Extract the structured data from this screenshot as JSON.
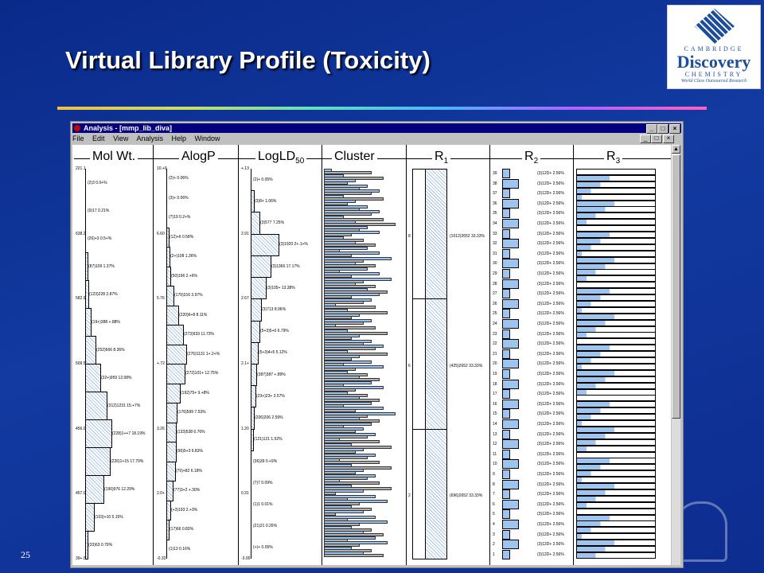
{
  "slide": {
    "title": "Virtual Library Profile (Toxicity)",
    "page_number": "25",
    "logo": {
      "line1": "CAMBRIDGE",
      "line2": "Discovery",
      "line3": "CHEMISTRY",
      "tagline": "World Class Outsourced Research"
    }
  },
  "window": {
    "title": "Analysis - [mmp_lib_diva]",
    "menu": [
      "File",
      "Edit",
      "View",
      "Analysis",
      "Help",
      "Window"
    ],
    "controls": {
      "minimize": "_",
      "maximize": "□",
      "close": "×"
    }
  },
  "columns": {
    "mol_wt": {
      "header": "Mol Wt.",
      "ticks": [
        "221.1",
        "638.2",
        "582.9",
        "509.5",
        "456.0",
        "457.0",
        "39+.5"
      ],
      "labels": [
        "(2)3 0.0+%",
        "(9)17 0.21%",
        "(26)+3 0.5+%",
        "(87)109 1.37%",
        "(123)228 2.87%",
        "(19+)388 +.88%",
        "(252)666 8.36%",
        "(32+)959 12.08%",
        "(312)1231 15.+7%",
        "(228)1++7 18.19%",
        "(226)1+15 17.79%",
        "(190)976 12.29%",
        "(103)+10 5.15%",
        "(33)63 0.79%"
      ]
    },
    "alogp": {
      "header": "AlogP",
      "ticks": [
        "10.+9",
        "6.60",
        "5.76",
        "+.72",
        "3.26",
        "2.0+",
        "-0.33"
      ],
      "labels": [
        "(2)+ 0.06%",
        "(3)+ 0.06%",
        "(7)19 0.2+%",
        "(12)+6 0.58%",
        "(2+)108 1.36%",
        "(50)196 2.+6%",
        "(170)316 3.97%",
        "(220)6+8 8.11%",
        "(273)933 11.73%",
        "(276)1131 1+.2+%",
        "(272)101+ 12.75%",
        "(192)75+ 9.+8%",
        "(176)599 7.53%",
        "(133)538 6.76%",
        "(96)5+3 6.83%",
        "(70)+82 6.18%",
        "(77)3+2 +.30%",
        "(+3)193 2.+3%",
        "(17)66 0.83%",
        "(1)13 0.16%"
      ]
    },
    "logld": {
      "header": "LogLD",
      "header_sub": "50",
      "ticks": [
        "+.13",
        "2.91",
        "2.67",
        "2.1+",
        "1.20",
        "0.31",
        "-3.00"
      ],
      "labels": [
        "(2)+ 0.05%",
        "(3)8+ 1.06%",
        "(3)577 7.25%",
        "(3)1920 2+.1+%",
        "(3)1366 17.17%",
        "(3)105+ 13.38%",
        "(3)713 8.96%",
        "(5+3)5+0 6.79%",
        "(5+3)4+5 5.12%",
        "(387)387 +.89%",
        "(23+)23+ 3.57%",
        "(206)206 2.59%",
        "(121)121 1.52%",
        "(36)39 0.+9%",
        "(7)7 0.09%",
        "(1)1 0.01%",
        "(21)21 0.26%",
        "(+)+ 0.05%"
      ]
    },
    "cluster": {
      "header": "Cluster"
    },
    "r1": {
      "header": "R",
      "header_sub": "1",
      "labels": [
        "(1012)2652 33.33%",
        "(425)2652 33.33%",
        "(696)2652 33.33%"
      ],
      "ticks": [
        "8",
        "6",
        "2"
      ]
    },
    "r2": {
      "header": "R",
      "header_sub": "2",
      "label": "(3)12D+ 2.56%"
    },
    "r3": {
      "header": "R",
      "header_sub": "3"
    }
  },
  "colors": {
    "bar_fill": "#9ec4f0",
    "hatch": "#a9c2e0",
    "background_dark": "#0d2c90",
    "cluster_gray": "#b0b0b0"
  }
}
